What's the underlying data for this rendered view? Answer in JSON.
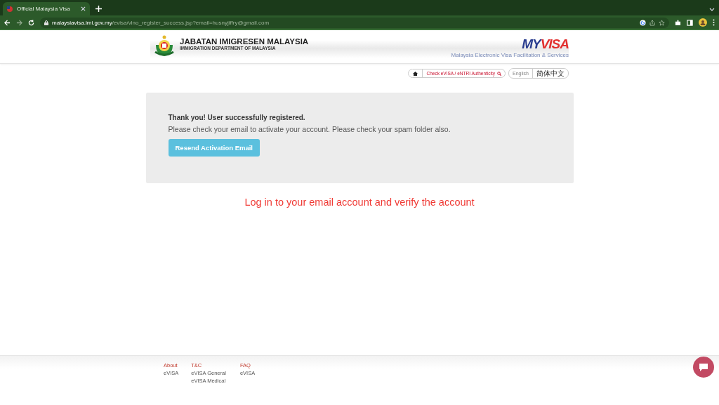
{
  "browser": {
    "tabs": [
      {
        "title": "Official Malaysia Visa",
        "selected": true
      }
    ],
    "url_host": "malaysiavisa.imi.gov.my",
    "url_path": "/evisa/vlno_register_success.jsp?email=husnyjiffry@gmail.com"
  },
  "header": {
    "title": "JABATAN IMIGRESEN MALAYSIA",
    "subtitle": "IMMIGRATION DEPARTMENT OF MALAYSIA",
    "logo_my": "MY",
    "logo_visa": "VISA",
    "tagline": "Malaysia Electronic Visa Facilitation & Services"
  },
  "nav": {
    "check_link": "Check eVISA / eNTRI Authenticity",
    "languages": [
      {
        "label": "English",
        "selected": true
      },
      {
        "label": "简体中文",
        "selected": false
      }
    ]
  },
  "notice": {
    "heading": "Thank you! User successfully registered.",
    "message": "Please check your email to activate your account. Please check your spam folder also.",
    "button": "Resend Activation Email"
  },
  "instruction": "Log in to your email account and verify the account",
  "footer": {
    "columns": [
      {
        "heading": "About",
        "links": [
          "eVISA"
        ]
      },
      {
        "heading": "T&C",
        "links": [
          "eVISA General",
          "eVISA Medical"
        ]
      },
      {
        "heading": "FAQ",
        "links": [
          "eVISA"
        ]
      }
    ]
  }
}
